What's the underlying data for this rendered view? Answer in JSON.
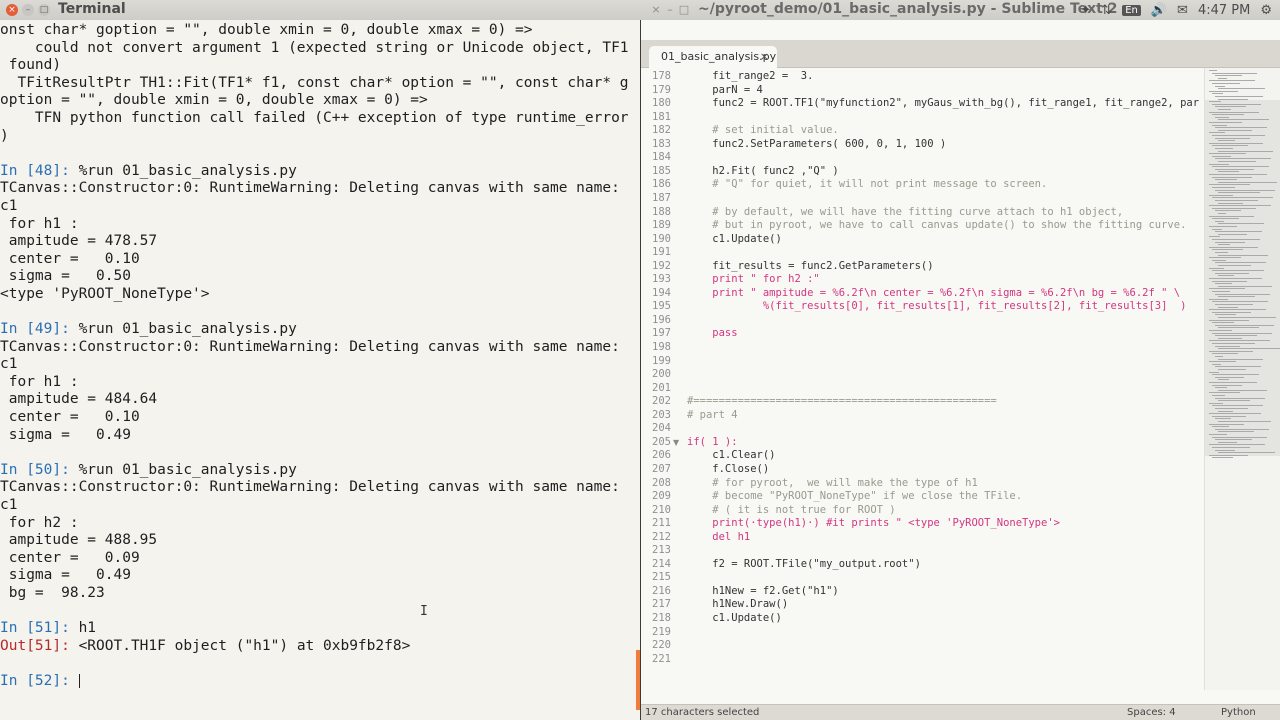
{
  "topbar": {
    "terminal_title": "Terminal",
    "sublime_title": "~/pyroot_demo/01_basic_analysis.py - Sublime Text 2",
    "tray_kbd": "En",
    "tray_time": "4:47 PM"
  },
  "terminal": {
    "lines": [
      "onst char* goption = \"\", double xmin = 0, double xmax = 0) =>",
      "    could not convert argument 1 (expected string or Unicode object, TF1",
      " found)",
      "  TFitResultPtr TH1::Fit(TF1* f1, const char* option = \"\", const char* g",
      "option = \"\", double xmin = 0, double xmax = 0) =>",
      "    TFN python function call failed (C++ exception of type runtime_error",
      ")",
      "",
      "In [48]: %run 01_basic_analysis.py",
      "TCanvas::Constructor:0: RuntimeWarning: Deleting canvas with same name:",
      "c1",
      " for h1 :",
      " ampitude = 478.57",
      " center =   0.10",
      " sigma =   0.50",
      "<type 'PyROOT_NoneType'>",
      "",
      "In [49]: %run 01_basic_analysis.py",
      "TCanvas::Constructor:0: RuntimeWarning: Deleting canvas with same name:",
      "c1",
      " for h1 :",
      " ampitude = 484.64",
      " center =   0.10",
      " sigma =   0.49",
      "",
      "In [50]: %run 01_basic_analysis.py",
      "TCanvas::Constructor:0: RuntimeWarning: Deleting canvas with same name:",
      "c1",
      " for h2 :",
      " ampitude = 488.95",
      " center =   0.09",
      " sigma =   0.49",
      " bg =  98.23",
      "",
      "In [51]: h1",
      "Out[51]: <ROOT.TH1F object (\"h1\") at 0xb9fb2f8>",
      "",
      "In [52]: "
    ]
  },
  "sublime": {
    "tab_label": "01_basic_analysis.py",
    "status_left": "17 characters selected",
    "status_spaces": "Spaces: 4",
    "status_syntax": "Python",
    "code": [
      {
        "n": "178",
        "t": "    fit_range2 =  3."
      },
      {
        "n": "179",
        "t": "    parN = 4"
      },
      {
        "n": "180",
        "t": "    func2 = ROOT.TF1(\"myfunction2\", myGaus_with_bg(), fit_range1, fit_range2, par"
      },
      {
        "n": "181",
        "t": ""
      },
      {
        "n": "182",
        "t": "    # set initial value."
      },
      {
        "n": "183",
        "t": "    func2.SetParameters( 600, 0, 1, 100 )"
      },
      {
        "n": "184",
        "t": ""
      },
      {
        "n": "185",
        "t": "    h2.Fit( func2 ,\"Q\" )"
      },
      {
        "n": "186",
        "t": "    # \"Q\" for quiet, it will not print message to screen."
      },
      {
        "n": "187",
        "t": ""
      },
      {
        "n": "188",
        "t": "    # by default, we will have the fitting curve attach to h1 object,"
      },
      {
        "n": "189",
        "t": "    # but in pyroot, we have to call canvas update() to show the fitting curve."
      },
      {
        "n": "190",
        "t": "    c1.Update()"
      },
      {
        "n": "191",
        "t": ""
      },
      {
        "n": "192",
        "t": "    fit_results = func2.GetParameters()"
      },
      {
        "n": "193",
        "t": "    print \" for h2 :\""
      },
      {
        "n": "194",
        "t": "    print \" ampitude = %6.2f\\n center = %6.2f\\n sigma = %6.2f\\n bg = %6.2f \" \\"
      },
      {
        "n": "195",
        "t": "            %(fit_results[0], fit_results[1], fit_results[2], fit_results[3]  )"
      },
      {
        "n": "196",
        "t": ""
      },
      {
        "n": "197",
        "t": "    pass"
      },
      {
        "n": "198",
        "t": ""
      },
      {
        "n": "199",
        "t": ""
      },
      {
        "n": "200",
        "t": ""
      },
      {
        "n": "201",
        "t": ""
      },
      {
        "n": "202",
        "t": "#================================================"
      },
      {
        "n": "203",
        "t": "# part 4"
      },
      {
        "n": "204",
        "t": ""
      },
      {
        "n": "205",
        "t": "if( 1 ):"
      },
      {
        "n": "206",
        "t": "    c1.Clear()"
      },
      {
        "n": "207",
        "t": "    f.Close()"
      },
      {
        "n": "208",
        "t": "    # for pyroot,  we will make the type of h1"
      },
      {
        "n": "209",
        "t": "    # become \"PyROOT_NoneType\" if we close the TFile."
      },
      {
        "n": "210",
        "t": "    # ( it is not true for ROOT )"
      },
      {
        "n": "211",
        "t": "    print(·type(h1)·) #it prints \" <type 'PyROOT_NoneType'>"
      },
      {
        "n": "212",
        "t": "    del h1"
      },
      {
        "n": "213",
        "t": ""
      },
      {
        "n": "214",
        "t": "    f2 = ROOT.TFile(\"my_output.root\")"
      },
      {
        "n": "215",
        "t": ""
      },
      {
        "n": "216",
        "t": "    h1New = f2.Get(\"h1\")"
      },
      {
        "n": "217",
        "t": "    h1New.Draw()"
      },
      {
        "n": "218",
        "t": "    c1.Update()"
      },
      {
        "n": "219",
        "t": ""
      },
      {
        "n": "220",
        "t": ""
      },
      {
        "n": "221",
        "t": ""
      }
    ]
  },
  "colors": {
    "terminal_bg": "#f4f3ee",
    "prompt": "#2a6fb5",
    "out_prompt": "#b52a2a",
    "close_button": "#e35d37"
  }
}
